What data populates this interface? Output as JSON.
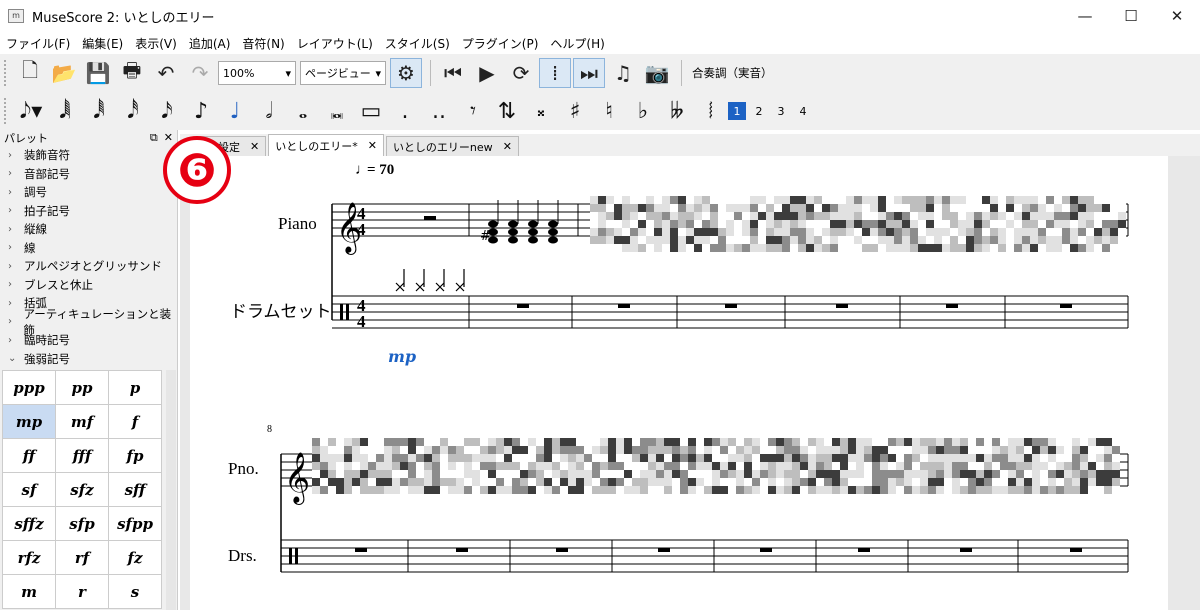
{
  "window": {
    "title": "MuseScore 2: いとしのエリー",
    "app_icon": "musescore-icon"
  },
  "menu": [
    "ファイル(F)",
    "編集(E)",
    "表示(V)",
    "追加(A)",
    "音符(N)",
    "レイアウト(L)",
    "スタイル(S)",
    "プラグイン(P)",
    "ヘルプ(H)"
  ],
  "toolbar": {
    "zoom_value": "100%",
    "view_value": "ページビュー",
    "concert_pitch": "合奏調（実音）"
  },
  "note_toolbar": {
    "voices": [
      "1",
      "2",
      "3",
      "4"
    ]
  },
  "palette": {
    "title": "パレット",
    "categories": [
      "装飾音符",
      "音部記号",
      "調号",
      "拍子記号",
      "縦線",
      "線",
      "アルペジオとグリッサンド",
      "ブレスと休止",
      "括弧",
      "アーティキュレーションと装飾",
      "臨時記号",
      "強弱記号"
    ],
    "dynamics": [
      "ppp",
      "pp",
      "p",
      "mp",
      "mf",
      "f",
      "ff",
      "fff",
      "fp",
      "sf",
      "sfz",
      "sff",
      "sffz",
      "sfp",
      "sfpp",
      "rfz",
      "rf",
      "fz",
      "m",
      "r",
      "s"
    ]
  },
  "tabs": [
    {
      "label": "未設定"
    },
    {
      "label": "いとしのエリー*"
    },
    {
      "label": "いとしのエリーnew"
    }
  ],
  "badge": "❻",
  "score": {
    "tempo": "= 70",
    "instr1": "Piano",
    "instr2": "ドラムセット",
    "dynamic": "mp",
    "measure_number": "8",
    "instr1_short": "Pno.",
    "instr2_short": "Drs.",
    "time_sig_top": "4",
    "time_sig_bottom": "4"
  },
  "colors": {
    "accent": "#1c62c4",
    "badge": "#e60012",
    "dynamic_mark": "#1c62c4"
  }
}
